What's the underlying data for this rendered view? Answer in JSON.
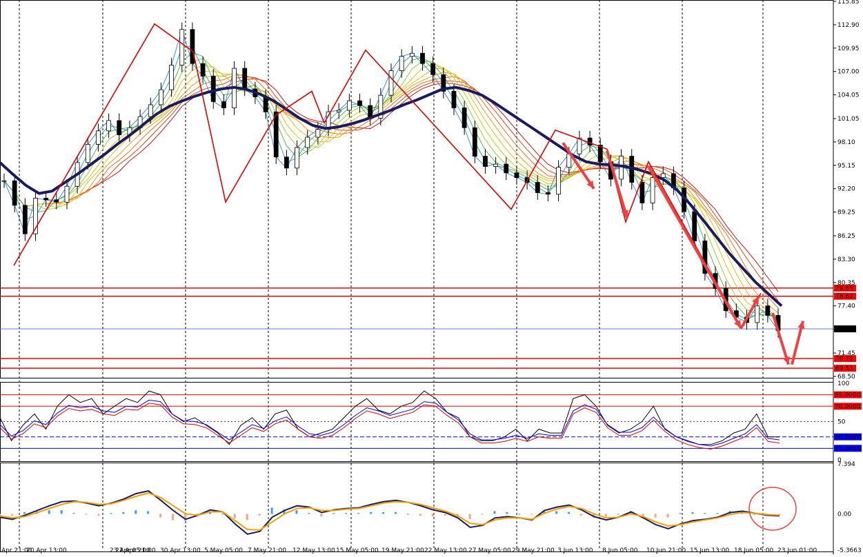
{
  "chart_data": [
    {
      "panel": "price",
      "type": "candlestick",
      "ylim": [
        68.5,
        115.85
      ],
      "y_ticks": [
        "115.85",
        "112.90",
        "109.95",
        "107.00",
        "104.05",
        "101.05",
        "98.10",
        "95.15",
        "92.20",
        "89.25",
        "86.25",
        "83.30",
        "80.35",
        "77.40",
        "74.45",
        "71.45",
        "68.50"
      ],
      "x_labels": [
        "Apr 21:00",
        "20 Apr 13:00",
        "23 Apr 05:00",
        "27 Apr 21:00",
        "30 Apr 13:00",
        "5 May 05:00",
        "7 May 21:00",
        "12 May 13:00",
        "15 May 05:00",
        "19 May 21:00",
        "22 May 13:00",
        "27 May 05:00",
        "29 May 21:00",
        "3 Jun 13:00",
        "8 Jun 05:00",
        "10 Jun 21:00",
        "15 Jun 13:00",
        "18 Jun 05:00",
        "23 Jun 01:00"
      ],
      "levels": [
        {
          "label": "79.65",
          "value": 79.65,
          "color": "#ff0000"
        },
        {
          "label": "78.62",
          "value": 78.62,
          "color": "#ff0000"
        },
        {
          "label": "70.75",
          "value": 70.75,
          "color": "#ff0000"
        },
        {
          "label": "69.53",
          "value": 69.53,
          "color": "#ff0000"
        }
      ],
      "current_price": {
        "label": "74.50",
        "value": 74.5
      },
      "series": [
        {
          "name": "close",
          "values": [
            93.2,
            90.1,
            86.5,
            91.0,
            90.8,
            90.5,
            92.5,
            95.5,
            97.8,
            99.5,
            100.8,
            99.0,
            99.9,
            101.3,
            102.8,
            104.7,
            107.8,
            112.3,
            108.0,
            106.4,
            103.2,
            102.4,
            107.4,
            104.8,
            103.8,
            101.9,
            96.2,
            94.8,
            97.4,
            98.7,
            99.7,
            101.9,
            102.1,
            103.3,
            102.7,
            101.1,
            104.0,
            107.1,
            108.9,
            109.3,
            108.0,
            106.6,
            104.5,
            102.4,
            99.9,
            96.3,
            95.0,
            95.3,
            94.2,
            93.6,
            93.0,
            91.7,
            91.5,
            94.9,
            96.6,
            98.6,
            97.7,
            95.6,
            93.4,
            96.3,
            93.0,
            90.4,
            93.6,
            94.1,
            92.3,
            89.3,
            85.6,
            81.5,
            79.6,
            76.8,
            76.0,
            75.3,
            77.4,
            76.2,
            74.3
          ]
        },
        {
          "name": "trend ma",
          "values": [
            95.5,
            94.0,
            92.6,
            91.6,
            91.9,
            93.0,
            94.1,
            95.3,
            96.5,
            97.8,
            99.0,
            100.3,
            101.6,
            102.6,
            103.3,
            103.9,
            104.4,
            104.8,
            105.0,
            104.7,
            104.1,
            103.3,
            102.2,
            101.1,
            100.2,
            99.8,
            100.0,
            100.4,
            100.9,
            101.5,
            102.1,
            102.8,
            103.4,
            104.1,
            104.8,
            105.0,
            104.6,
            104.0,
            103.0,
            101.9,
            100.8,
            99.7,
            98.6,
            97.5,
            96.4,
            95.6,
            95.3,
            95.2,
            95.0,
            94.6,
            94.1,
            93.3,
            92.0,
            90.2,
            88.2,
            86.1,
            84.0,
            82.2,
            80.4,
            78.9,
            77.4
          ]
        },
        {
          "name": "zigzag",
          "values": [
            82.5,
            99.0,
            113.0,
            100.0,
            109.5,
            90.5,
            101.5,
            104.5,
            100.5,
            109.7,
            104.5,
            96.8,
            89.6,
            95.4,
            99.6,
            92.1,
            97.2,
            88.0,
            95.6,
            74.6,
            79.0,
            70.0,
            74.9
          ]
        }
      ]
    },
    {
      "panel": "stochastic",
      "type": "line",
      "ylim": [
        0,
        100
      ],
      "y_ticks": [
        "100",
        "50",
        "0"
      ],
      "levels": [
        {
          "label": "85.0000",
          "value": 85,
          "color": "#ff0000"
        },
        {
          "label": "70.0000",
          "value": 70,
          "color": "#ff0000"
        },
        {
          "label": "30.0000",
          "value": 30,
          "color": "#0000ff"
        },
        {
          "label": "15.0000",
          "value": 15,
          "color": "#0000ff"
        }
      ],
      "series": [
        {
          "name": "main",
          "values": [
            55,
            25,
            45,
            60,
            40,
            70,
            85,
            75,
            80,
            60,
            70,
            80,
            75,
            90,
            85,
            60,
            50,
            55,
            45,
            35,
            20,
            45,
            55,
            40,
            60,
            65,
            40,
            30,
            35,
            40,
            55,
            70,
            80,
            65,
            60,
            70,
            75,
            90,
            80,
            62,
            55,
            30,
            25,
            25,
            30,
            40,
            25,
            40,
            35,
            35,
            80,
            85,
            70,
            45,
            35,
            40,
            50,
            70,
            40,
            30,
            25,
            20,
            20,
            25,
            35,
            40,
            60,
            30,
            30
          ]
        },
        {
          "name": "signal",
          "values": [
            50,
            35,
            42,
            55,
            50,
            65,
            75,
            72,
            74,
            68,
            66,
            74,
            73,
            82,
            80,
            64,
            55,
            54,
            50,
            40,
            30,
            40,
            50,
            45,
            55,
            60,
            48,
            38,
            36,
            40,
            50,
            62,
            72,
            68,
            62,
            66,
            70,
            80,
            78,
            66,
            56,
            38,
            30,
            30,
            32,
            36,
            32,
            38,
            36,
            36,
            68,
            76,
            70,
            50,
            40,
            40,
            46,
            60,
            45,
            34,
            28,
            24,
            22,
            26,
            32,
            38,
            50,
            32,
            30
          ]
        }
      ]
    },
    {
      "panel": "macd",
      "type": "line",
      "ylim": [
        -5.3663,
        7.394
      ],
      "y_ticks": [
        "7.394",
        "0.00",
        "-5.3663"
      ],
      "series": [
        {
          "name": "macd",
          "values": [
            -0.5,
            -0.8,
            -0.2,
            0.5,
            1.2,
            1.8,
            1.9,
            1.6,
            1.2,
            1.6,
            2.2,
            3.0,
            3.4,
            2.0,
            0.5,
            -0.8,
            -0.2,
            0.6,
            0.3,
            -1.5,
            -3.0,
            -2.6,
            -0.5,
            0.5,
            1.2,
            1.0,
            0.2,
            0.6,
            0.8,
            0.9,
            1.4,
            1.8,
            2.0,
            1.7,
            1.2,
            0.6,
            0.2,
            -0.6,
            -2.0,
            -1.7,
            -0.6,
            -0.4,
            -0.6,
            -0.9,
            0.5,
            1.0,
            1.3,
            0.6,
            -0.4,
            -0.9,
            -0.5,
            0.3,
            -0.6,
            -1.6,
            -2.2,
            -1.5,
            -1.0,
            -0.8,
            -0.5,
            0.2,
            0.4,
            0.1,
            -0.2,
            -0.3
          ]
        },
        {
          "name": "signal",
          "values": [
            -0.3,
            -0.6,
            -0.4,
            0.2,
            0.8,
            1.4,
            1.8,
            1.7,
            1.4,
            1.5,
            2.0,
            2.6,
            3.1,
            2.4,
            1.2,
            0.0,
            -0.2,
            0.3,
            0.3,
            -1.0,
            -2.3,
            -2.4,
            -1.2,
            0.0,
            0.8,
            0.9,
            0.5,
            0.5,
            0.7,
            0.8,
            1.2,
            1.6,
            1.8,
            1.7,
            1.4,
            0.9,
            0.4,
            -0.3,
            -1.4,
            -1.6,
            -0.9,
            -0.6,
            -0.6,
            -0.8,
            0.1,
            0.7,
            1.1,
            0.8,
            0.0,
            -0.6,
            -0.5,
            0.0,
            -0.4,
            -1.2,
            -1.8,
            -1.6,
            -1.2,
            -0.9,
            -0.6,
            -0.1,
            0.2,
            0.1,
            -0.1,
            -0.2
          ]
        }
      ]
    }
  ]
}
